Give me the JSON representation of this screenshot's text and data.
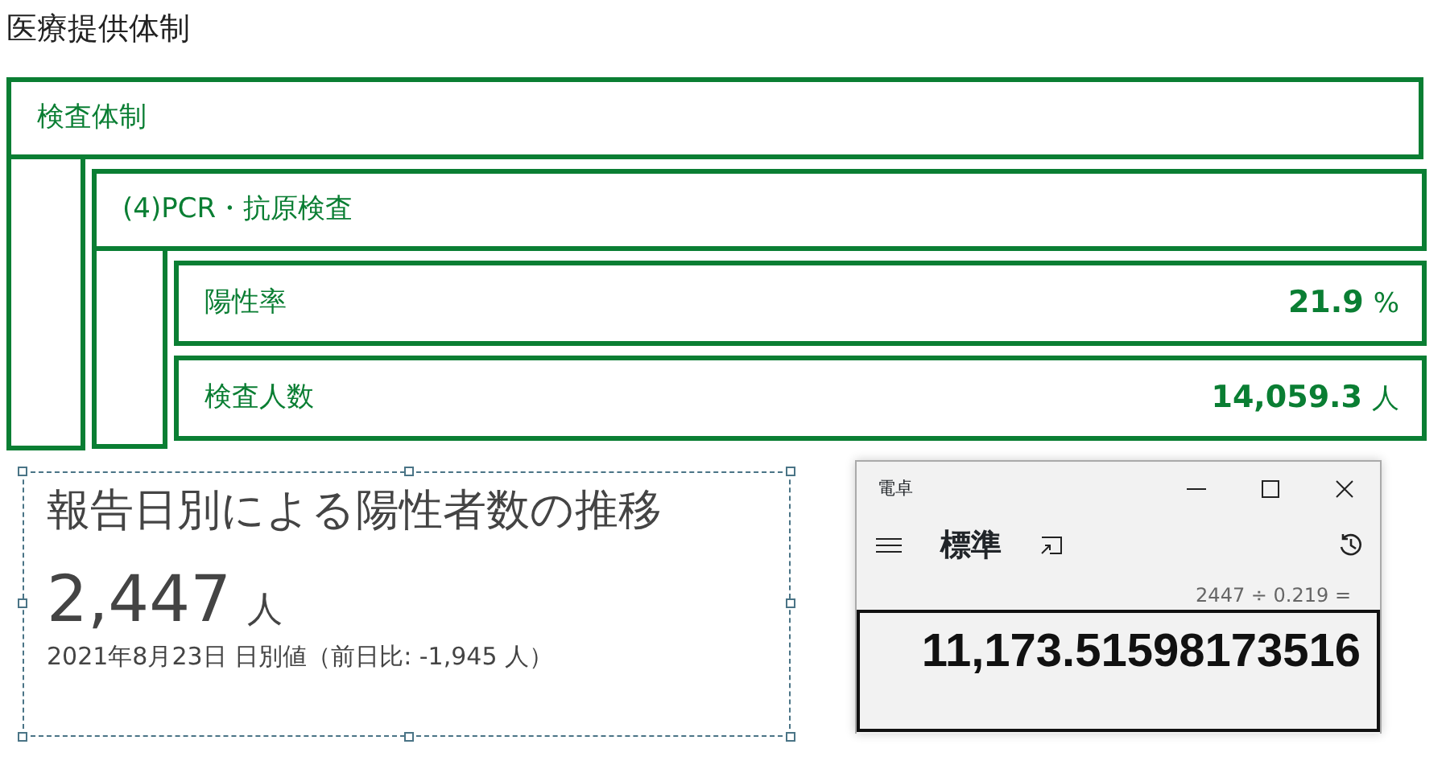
{
  "page_title": "医療提供体制",
  "section": {
    "title": "検査体制",
    "subsection": {
      "title": "(4)PCR・抗原検査",
      "metrics": [
        {
          "label": "陽性率",
          "value": "21.9",
          "unit": "%"
        },
        {
          "label": "検査人数",
          "value": "14,059.3",
          "unit": "人"
        }
      ]
    }
  },
  "card": {
    "title": "報告日別による陽性者数の推移",
    "value": "2,447",
    "unit": "人",
    "caption": "2021年8月23日 日別値（前日比: -1,945 人）"
  },
  "calculator": {
    "title": "電卓",
    "mode": "標準",
    "expression": "2447 ÷ 0.219 =",
    "result": "11,173.51598173516"
  }
}
